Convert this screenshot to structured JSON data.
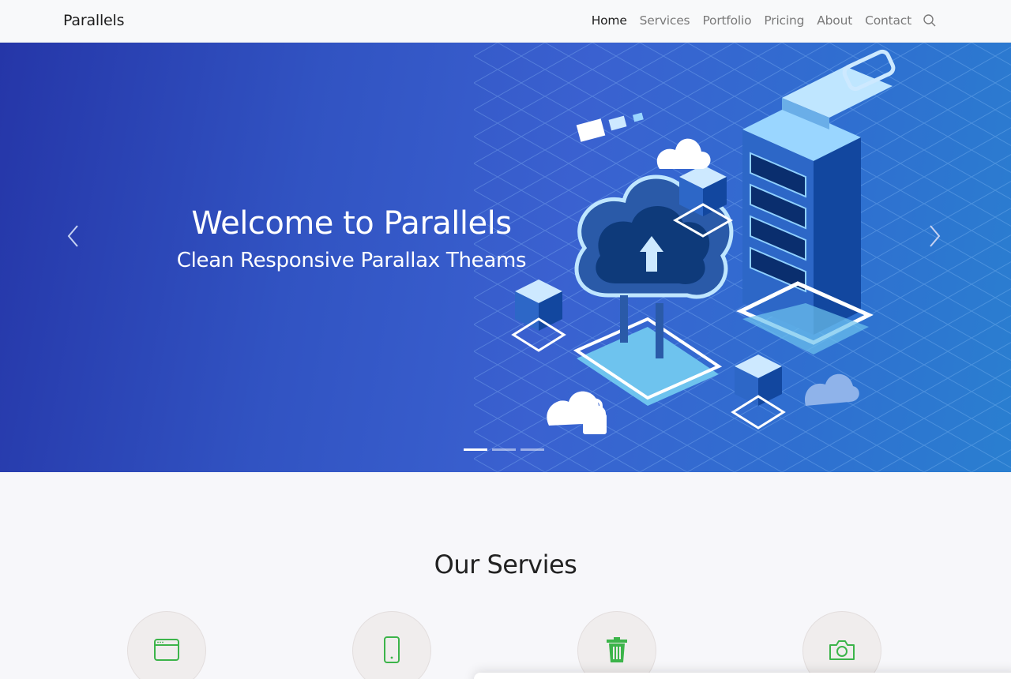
{
  "navbar": {
    "brand": "Parallels",
    "links": [
      {
        "label": "Home",
        "active": true
      },
      {
        "label": "Services"
      },
      {
        "label": "Portfolio"
      },
      {
        "label": "Pricing"
      },
      {
        "label": "About"
      },
      {
        "label": "Contact"
      }
    ],
    "search_icon": "search-icon"
  },
  "hero": {
    "title": "Welcome to Parallels",
    "subtitle": "Clean Responsive Parallax Theams",
    "slide_count": 3,
    "active_slide": 1,
    "prev_icon": "chevron-left-icon",
    "next_icon": "chevron-right-icon"
  },
  "services": {
    "title": "Our Servies",
    "icon_color": "#3cb44a",
    "items": [
      {
        "icon": "browser-window-icon"
      },
      {
        "icon": "mobile-phone-icon"
      },
      {
        "icon": "trash-icon"
      },
      {
        "icon": "camera-icon"
      }
    ]
  },
  "colors": {
    "hero_gradient_start": "#2536a8",
    "hero_gradient_end": "#2a7fd0",
    "accent_green": "#3cb44a"
  }
}
